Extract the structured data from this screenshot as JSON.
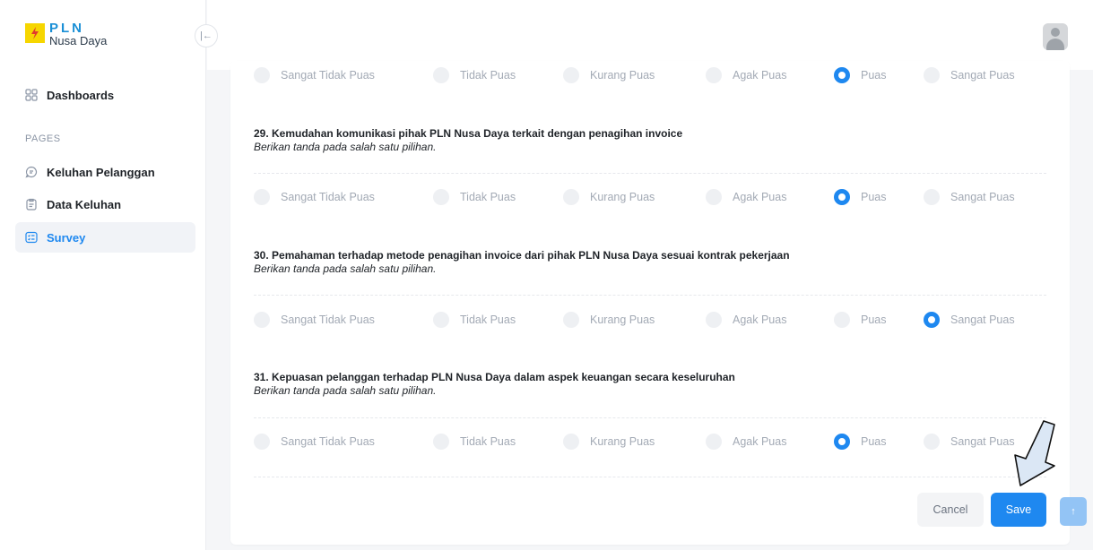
{
  "logo": {
    "title": "PLN",
    "subtitle": "Nusa Daya"
  },
  "collapse": {
    "glyph": "|←"
  },
  "nav": {
    "dashboards": "Dashboards",
    "section_label": "PAGES",
    "keluhan": "Keluhan Pelanggan",
    "data_keluhan": "Data Keluhan",
    "survey": "Survey"
  },
  "options": [
    "Sangat Tidak Puas",
    "Tidak Puas",
    "Kurang Puas",
    "Agak Puas",
    "Puas",
    "Sangat Puas"
  ],
  "hint": "Berikan tanda pada salah satu pilihan.",
  "questions": [
    {
      "title": "29. Kemudahan komunikasi pihak PLN Nusa Daya terkait dengan penagihan invoice",
      "selected": "Puas"
    },
    {
      "title": "30. Pemahaman terhadap metode penagihan invoice dari pihak PLN Nusa Daya sesuai kontrak pekerjaan",
      "selected": "Sangat Puas"
    },
    {
      "title": "31. Kepuasan pelanggan terhadap PLN Nusa Daya dalam aspek keuangan secara keseluruhan",
      "selected": "Puas"
    }
  ],
  "previous_row": {
    "selected": "Puas"
  },
  "buttons": {
    "cancel": "Cancel",
    "save": "Save",
    "scroll_top": "↑"
  },
  "colors": {
    "accent": "#1e88f0",
    "logo_yellow": "#f6d600"
  }
}
